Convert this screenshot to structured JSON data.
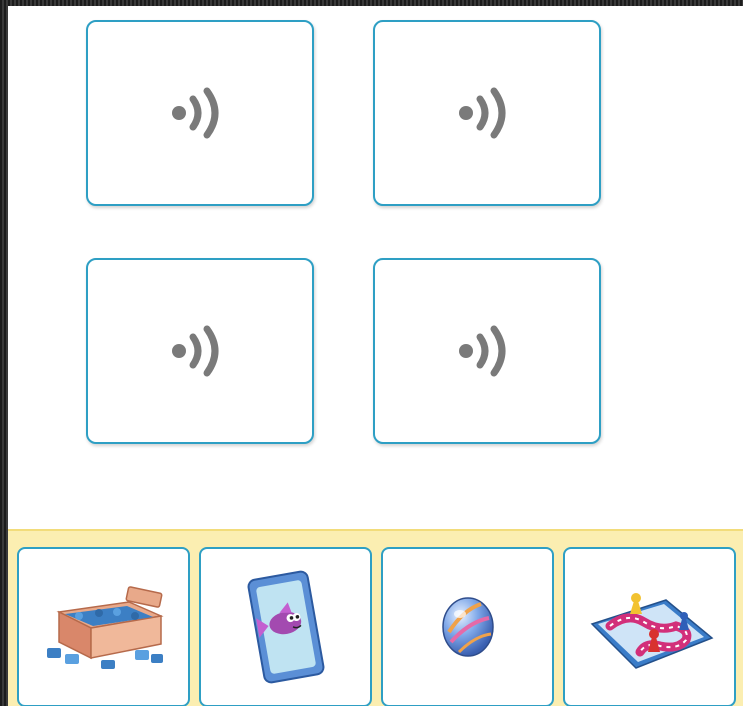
{
  "sound_cards": [
    {
      "icon": "speaker-sound-icon"
    },
    {
      "icon": "speaker-sound-icon"
    },
    {
      "icon": "speaker-sound-icon"
    },
    {
      "icon": "speaker-sound-icon"
    }
  ],
  "choices": [
    {
      "icon": "jigsaw-puzzle-box-icon"
    },
    {
      "icon": "fish-card-icon"
    },
    {
      "icon": "marble-icon"
    },
    {
      "icon": "board-game-icon"
    }
  ],
  "colors": {
    "card_border": "#2e9fc4",
    "tray_background": "#fbeeb1",
    "sound_icon": "#7a7a7a"
  }
}
